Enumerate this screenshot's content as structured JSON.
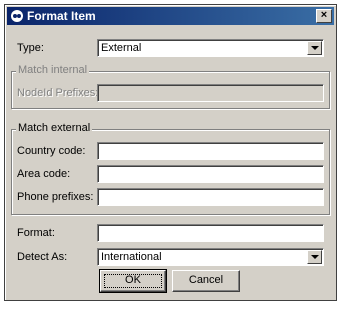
{
  "window": {
    "title": "Format Item"
  },
  "type": {
    "label": "Type:",
    "value": "External"
  },
  "match_internal": {
    "legend": "Match internal",
    "nodeid_label": "NodeId Prefixes:",
    "nodeid_value": ""
  },
  "match_external": {
    "legend": "Match external",
    "country_label": "Country code:",
    "country_value": "",
    "area_label": "Area code:",
    "area_value": "",
    "phone_label": "Phone prefixes:",
    "phone_value": ""
  },
  "format": {
    "label": "Format:",
    "value": ""
  },
  "detect_as": {
    "label": "Detect As:",
    "value": "International"
  },
  "buttons": {
    "ok": "OK",
    "cancel": "Cancel"
  },
  "icons": {
    "app": "format-icon",
    "close": "close-icon",
    "dropdown": "chevron-down-icon"
  }
}
